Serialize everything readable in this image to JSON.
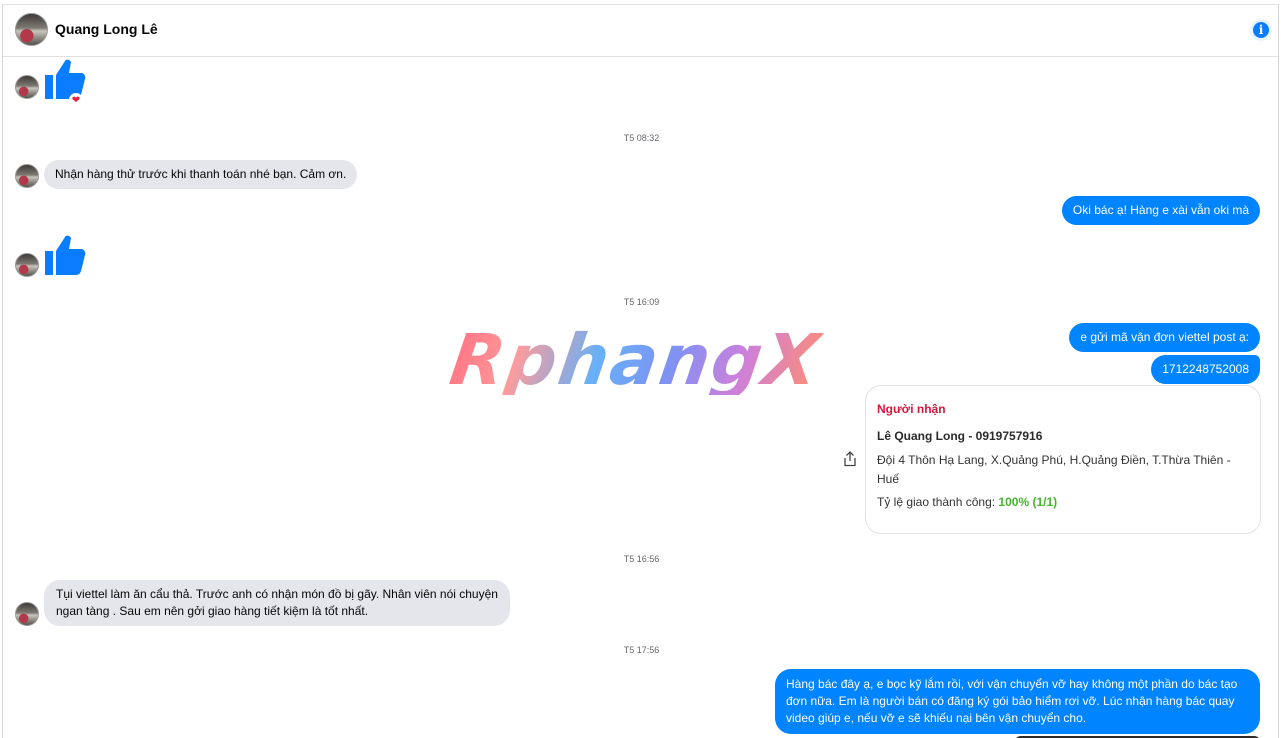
{
  "header": {
    "contact_name": "Quang Long Lê",
    "info_icon": "info-icon"
  },
  "timestamps": [
    "T5 08:32",
    "T5 16:09",
    "T5 16:56",
    "T5 17:56"
  ],
  "messages": {
    "in_1": "Nhận hàng thử trước khi thanh toán nhé bạn. Cảm ơn.",
    "out_1": "Oki bác ạ! Hàng e xài vẫn oki mà",
    "out_2": "e gửi mã vận đơn viettel post ạ:",
    "out_3": "1712248752008",
    "in_2_line1": "Tụi viettel làm ăn cẩu thả. Trước anh có nhận món đồ bị gãy. Nhân viên nói chuyện",
    "in_2_line2": "ngan tàng . Sau em nên gởi giao hàng tiết kiệm là tốt nhất.",
    "out_4_line1": "Hàng bác đây ạ, e bọc kỹ lắm rồi, với vận chuyển vỡ hay không một phần do bác tạo",
    "out_4_line2": "đơn nữa. Em là người bán có đăng ký gói bảo hiểm rơi vỡ. Lúc nhận hàng bác quay",
    "out_4_line3": "video giúp e, nếu vỡ e sẽ khiếu nại bên vận chuyển cho."
  },
  "card": {
    "title": "Người nhận",
    "name": "Lê Quang Long - 0919757916",
    "address_line1": "Đội 4 Thôn Hạ Lang, X.Quảng Phú, H.Quảng Điền, T.Thừa Thiên -",
    "address_line2": "Huế",
    "rate_label": "Tỷ lệ giao thành công:",
    "rate_value": "100% (1/1)"
  },
  "reaction": "❤",
  "watermark": "RphangX",
  "colors": {
    "accent": "#0084ff",
    "incoming_bubble": "#e4e6eb",
    "card_title": "#d6173b",
    "rate_green": "#42b72a"
  }
}
